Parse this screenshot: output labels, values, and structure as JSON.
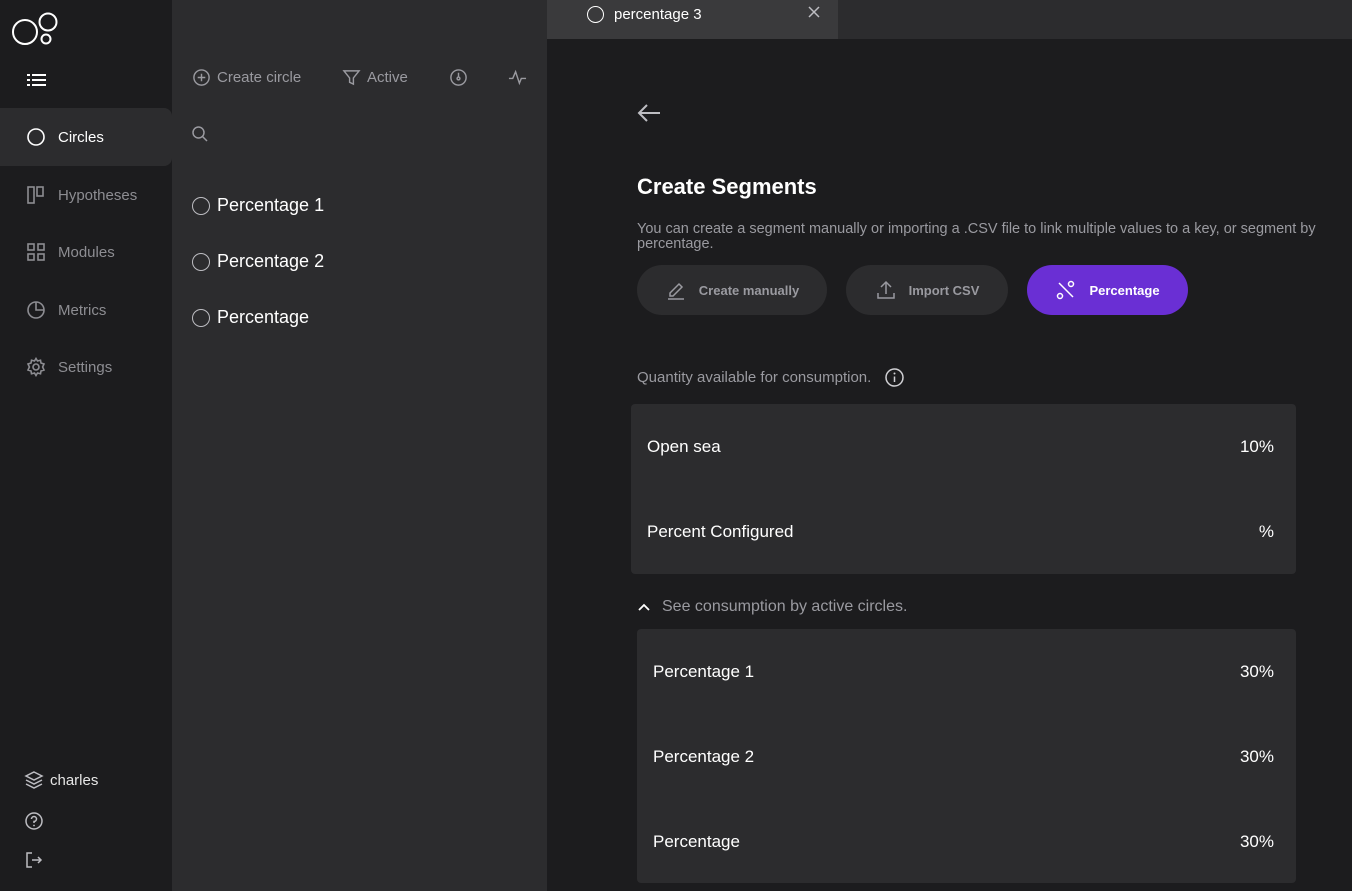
{
  "sidebar": {
    "items": [
      {
        "label": "Circles",
        "icon": "circle-icon"
      },
      {
        "label": "Hypotheses",
        "icon": "board-icon"
      },
      {
        "label": "Modules",
        "icon": "grid-icon"
      },
      {
        "label": "Metrics",
        "icon": "pie-chart-icon"
      },
      {
        "label": "Settings",
        "icon": "gear-icon"
      }
    ],
    "workspace": "charles"
  },
  "list": {
    "toolbar": {
      "create_label": "Create circle",
      "filter_label": "Active"
    },
    "circles": [
      "Percentage 1",
      "Percentage 2",
      "Percentage"
    ]
  },
  "tab": {
    "label": "percentage 3"
  },
  "main": {
    "title": "Create Segments",
    "description": "You can create a segment manually or importing a .CSV file to link multiple values to a key, or segment by percentage.",
    "buttons": {
      "manual": "Create manually",
      "csv": "Import CSV",
      "percentage": "Percentage"
    },
    "quantity_label": "Quantity available for consumption.",
    "quantity": [
      {
        "label": "Open sea",
        "value": "10%"
      },
      {
        "label": "Percent Configured",
        "value": "%"
      }
    ],
    "consumption_toggle": "See consumption by active circles.",
    "consumption": [
      {
        "label": "Percentage 1",
        "value": "30%"
      },
      {
        "label": "Percentage 2",
        "value": "30%"
      },
      {
        "label": "Percentage",
        "value": "30%"
      }
    ]
  },
  "colors": {
    "accent": "#6a2fd4",
    "panel": "#2c2c2e",
    "background": "#1c1c1e"
  }
}
